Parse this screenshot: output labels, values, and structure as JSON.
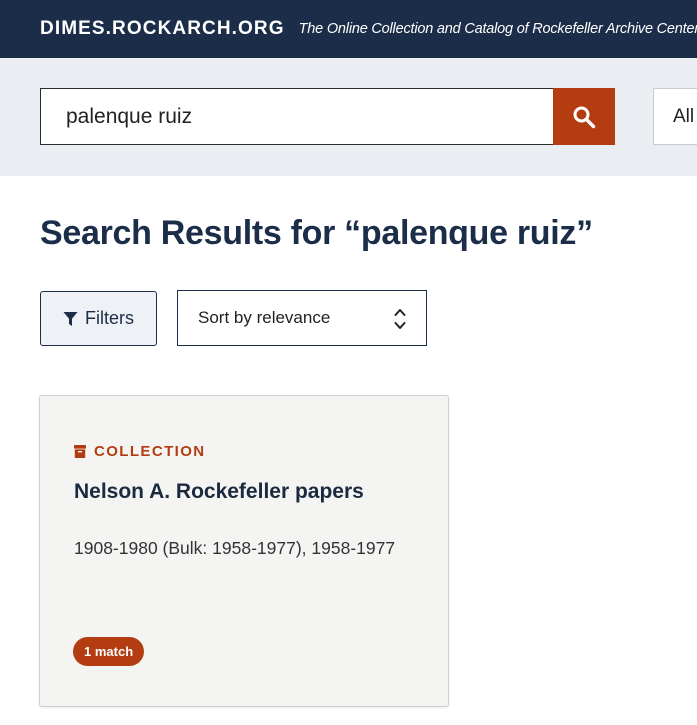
{
  "header": {
    "site_name": "DIMES.ROCKARCH.ORG",
    "tagline": "The Online Collection and Catalog of Rockefeller Archive Center",
    "background_color": "#1b2d48"
  },
  "search": {
    "query": "palenque ruiz",
    "button_icon": "search-icon",
    "button_color": "#b33d10",
    "scope_value": "All"
  },
  "results": {
    "title": "Search Results for “palenque ruiz”",
    "filters_label": "Filters",
    "filters_icon": "filter-icon",
    "sort_value": "Sort by relevance",
    "sort_icon": "chevron-up-down-icon",
    "items": [
      {
        "type_icon": "archive-box-icon",
        "type": "COLLECTION",
        "title": "Nelson A. Rockefeller papers",
        "dates": "1908-1980 (Bulk: 1958-1977), 1958-1977",
        "match_badge": "1 match"
      }
    ]
  },
  "colors": {
    "accent": "#b33d10",
    "navy": "#1b2d48",
    "search_band": "#eaedf2",
    "card_background": "#f4f4f2"
  }
}
